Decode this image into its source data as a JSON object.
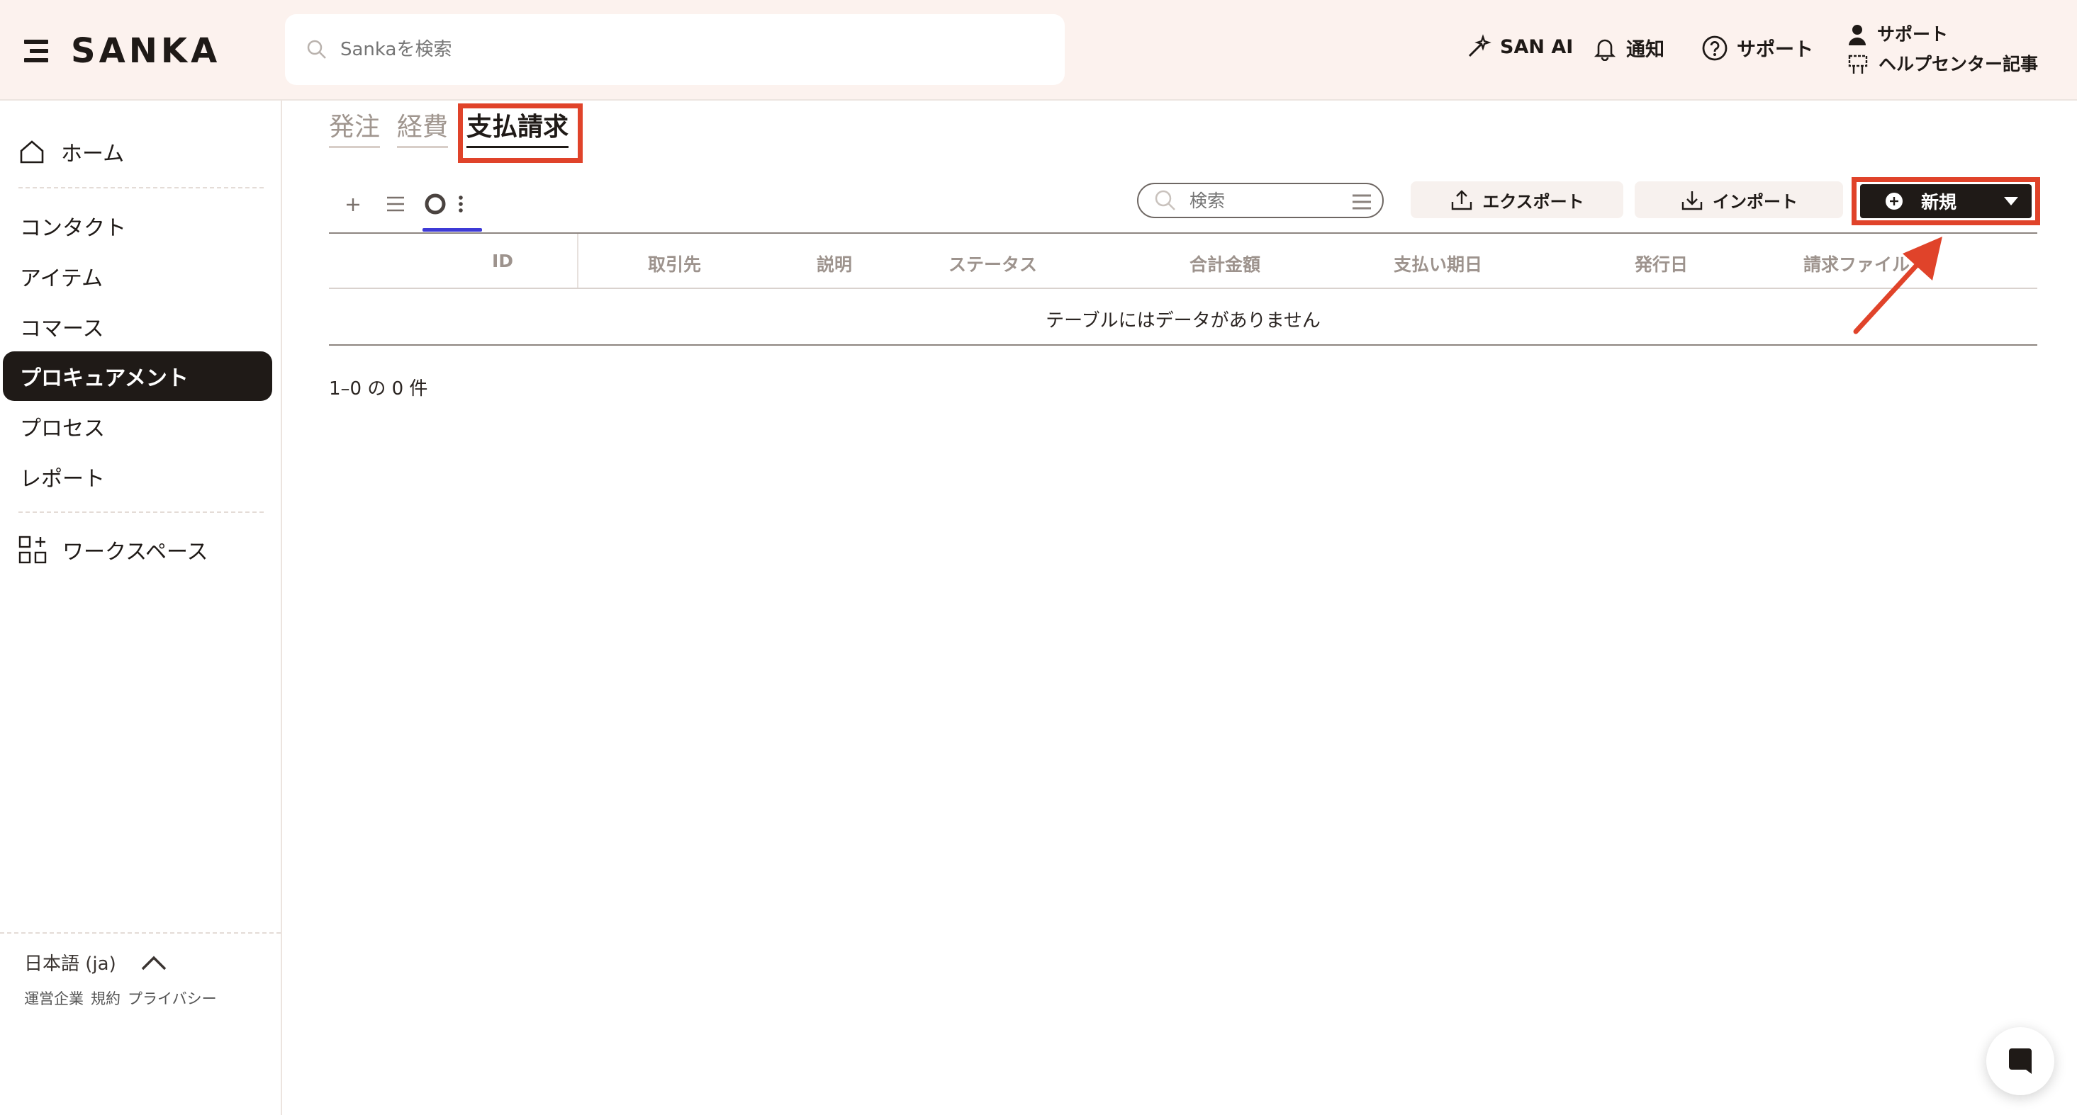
{
  "header": {
    "logo_text": "SANKA",
    "search_placeholder": "Sankaを検索",
    "san_ai": "SAN AI",
    "notifications": "通知",
    "support": "サポート",
    "account_support": "サポート",
    "help_center": "ヘルプセンター記事"
  },
  "sidebar": {
    "home": "ホーム",
    "items": [
      "コンタクト",
      "アイテム",
      "コマース",
      "プロキュアメント",
      "プロセス",
      "レポート"
    ],
    "active_index": 3,
    "workspace": "ワークスペース",
    "language": "日本語 (ja)",
    "footer_links": [
      "運営企業",
      "規約",
      "プライバシー"
    ]
  },
  "tabs": [
    "発注",
    "経費",
    "支払請求"
  ],
  "active_tab": 2,
  "toolbar": {
    "search_placeholder": "検索",
    "export": "エクスポート",
    "import": "インポート",
    "new": "新規"
  },
  "table": {
    "columns": [
      "ID",
      "取引先",
      "説明",
      "ステータス",
      "合計金額",
      "支払い期日",
      "発行日",
      "請求ファイル"
    ],
    "empty_message": "テーブルにはデータがありません",
    "count_text": "1–0 の 0 件"
  },
  "colors": {
    "header_bg": "#fcf2ee",
    "dark": "#1f1a17",
    "highlight": "#e0432a",
    "view_underline": "#3e3ad6"
  }
}
